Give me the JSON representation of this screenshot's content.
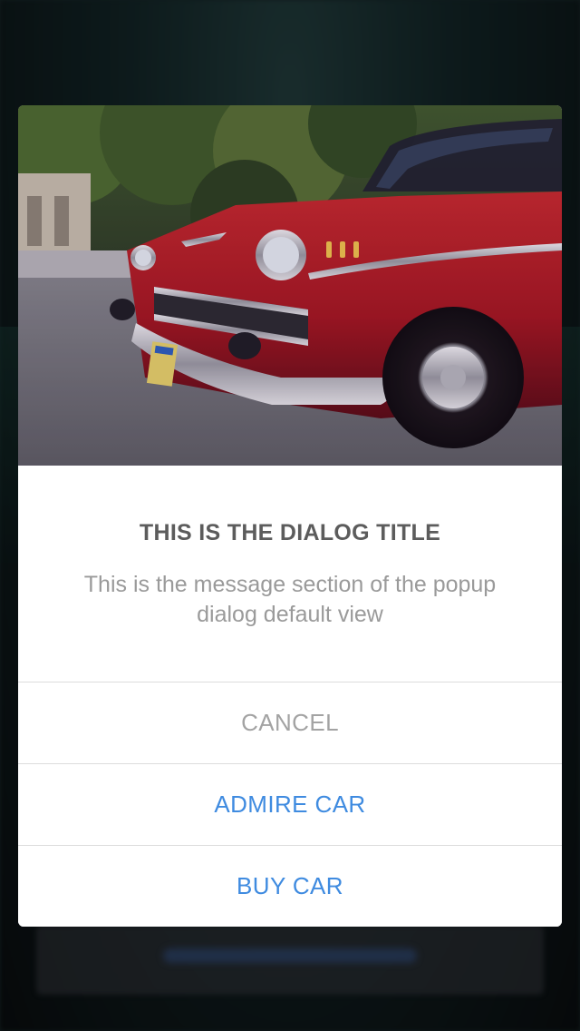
{
  "dialog": {
    "title": "THIS IS THE DIALOG TITLE",
    "message": "This is the message section of the popup dialog default view",
    "image": {
      "subject": "red classic car"
    },
    "buttons": [
      {
        "label": "CANCEL",
        "style": "cancel",
        "color": "#A3A3A3"
      },
      {
        "label": "ADMIRE CAR",
        "style": "default",
        "color": "#3F8BE0"
      },
      {
        "label": "BUY CAR",
        "style": "default",
        "color": "#3F8BE0"
      }
    ]
  }
}
